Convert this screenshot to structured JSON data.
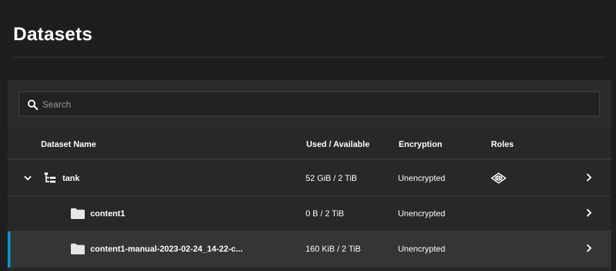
{
  "page": {
    "title": "Datasets"
  },
  "search": {
    "placeholder": "Search",
    "value": ""
  },
  "table": {
    "columns": [
      "Dataset Name",
      "Used / Available",
      "Encryption",
      "Roles"
    ],
    "rows": [
      {
        "name": "tank",
        "used": "52 GiB / 2 TiB",
        "encryption": "Unencrypted",
        "roles_icon": "share-network-icon",
        "type_icon": "tree-icon",
        "expanded": true,
        "selected": false
      },
      {
        "name": "content1",
        "used": "0 B / 2 TiB",
        "encryption": "Unencrypted",
        "roles_icon": "",
        "type_icon": "folder-icon",
        "selected": false
      },
      {
        "name": "content1-manual-2023-02-24_14-22-c...",
        "used": "160 KiB / 2 TiB",
        "encryption": "Unencrypted",
        "roles_icon": "",
        "type_icon": "folder-icon",
        "selected": true
      }
    ]
  },
  "colors": {
    "background": "#1e1e1e",
    "panel": "#282828",
    "selected_row": "#353535",
    "accent": "#0095d5"
  }
}
